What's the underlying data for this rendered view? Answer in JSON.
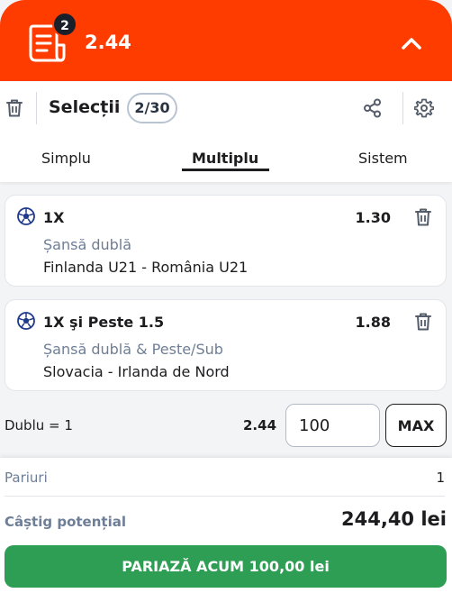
{
  "header": {
    "badge_count": "2",
    "total_odds": "2.44",
    "accent_color": "#ff3c00"
  },
  "toolbar": {
    "title": "Selecții",
    "selection_count": "2/30",
    "icons": [
      "trash-icon",
      "share-icon",
      "gear-icon"
    ]
  },
  "tabs": [
    {
      "label": "Simplu",
      "active": false
    },
    {
      "label": "Multiplu",
      "active": true
    },
    {
      "label": "Sistem",
      "active": false
    }
  ],
  "selections": [
    {
      "pick": "1X",
      "odds": "1.30",
      "market": "Șansă dublă",
      "event": "Finlanda U21 - România U21",
      "sport_icon": "football-icon"
    },
    {
      "pick": "1X şi Peste 1.5",
      "odds": "1.88",
      "market": "Șansă dublă & Peste/Sub",
      "event": "Slovacia - Irlanda de Nord",
      "sport_icon": "football-icon"
    }
  ],
  "stake": {
    "label": "Dublu = 1",
    "odds": "2.44",
    "amount": "100",
    "max_label": "MAX"
  },
  "summary": {
    "bets_label": "Pariuri",
    "bets_value": "1",
    "win_label": "Câștig potențial",
    "win_value": "244,40 lei",
    "place_bet_label": "PARIAZĂ ACUM 100,00 lei",
    "place_bet_color": "#2e9e54"
  }
}
